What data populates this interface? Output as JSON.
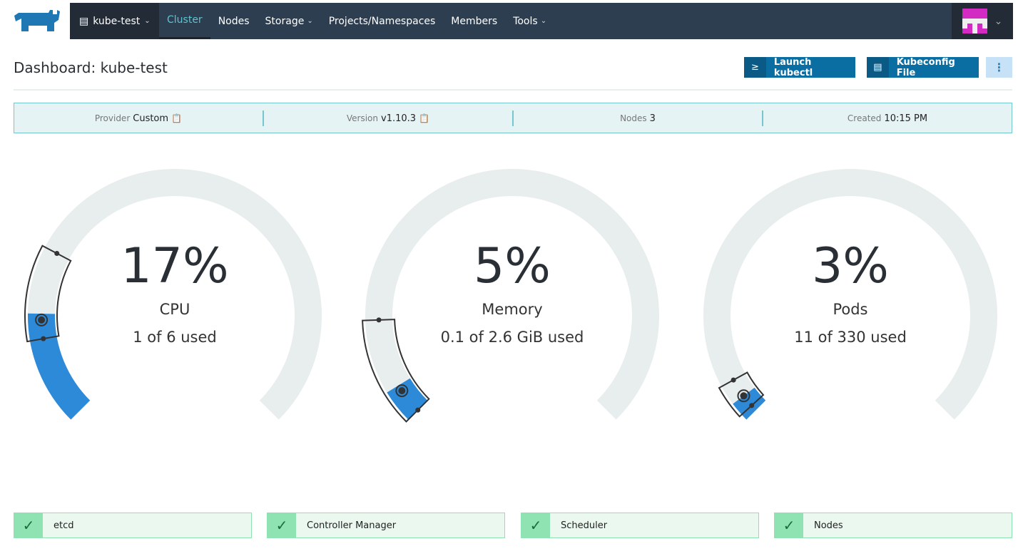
{
  "nav": {
    "cluster": "kube-test",
    "items": [
      {
        "label": "Cluster",
        "active": true
      },
      {
        "label": "Nodes"
      },
      {
        "label": "Storage",
        "dropdown": true
      },
      {
        "label": "Projects/Namespaces"
      },
      {
        "label": "Members"
      },
      {
        "label": "Tools",
        "dropdown": true
      }
    ]
  },
  "page": {
    "title": "Dashboard: kube-test",
    "launch_kubectl": "Launch kubectl",
    "kubeconfig": "Kubeconfig File",
    "more": "⋮"
  },
  "info": [
    {
      "key": "Provider",
      "value": "Custom",
      "copy": true
    },
    {
      "key": "Version",
      "value": "v1.10.3",
      "copy": true
    },
    {
      "key": "Nodes",
      "value": "3"
    },
    {
      "key": "Created",
      "value": "10:15 PM"
    }
  ],
  "gauges": [
    {
      "percent_label": "17%",
      "label": "CPU",
      "detail": "1 of 6 used",
      "fraction": 0.17,
      "range": [
        0.13,
        0.27
      ],
      "marker": 0.16
    },
    {
      "percent_label": "5%",
      "label": "Memory",
      "detail": "0.1 of 2.6 GiB used",
      "fraction": 0.05,
      "range": [
        0.0,
        0.16
      ],
      "marker": 0.04
    },
    {
      "percent_label": "3%",
      "label": "Pods",
      "detail": "11 of 330 used",
      "fraction": 0.03,
      "range": [
        0.01,
        0.06
      ],
      "marker": 0.03
    }
  ],
  "status": [
    {
      "label": "etcd"
    },
    {
      "label": "Controller Manager"
    },
    {
      "label": "Scheduler"
    },
    {
      "label": "Nodes"
    }
  ],
  "colors": {
    "nav": "#2d3e50",
    "accent": "#5fc4d0",
    "gauge_fill": "#2c8ad8",
    "gauge_track": "#e8eded",
    "ok": "#8fe3b2"
  }
}
